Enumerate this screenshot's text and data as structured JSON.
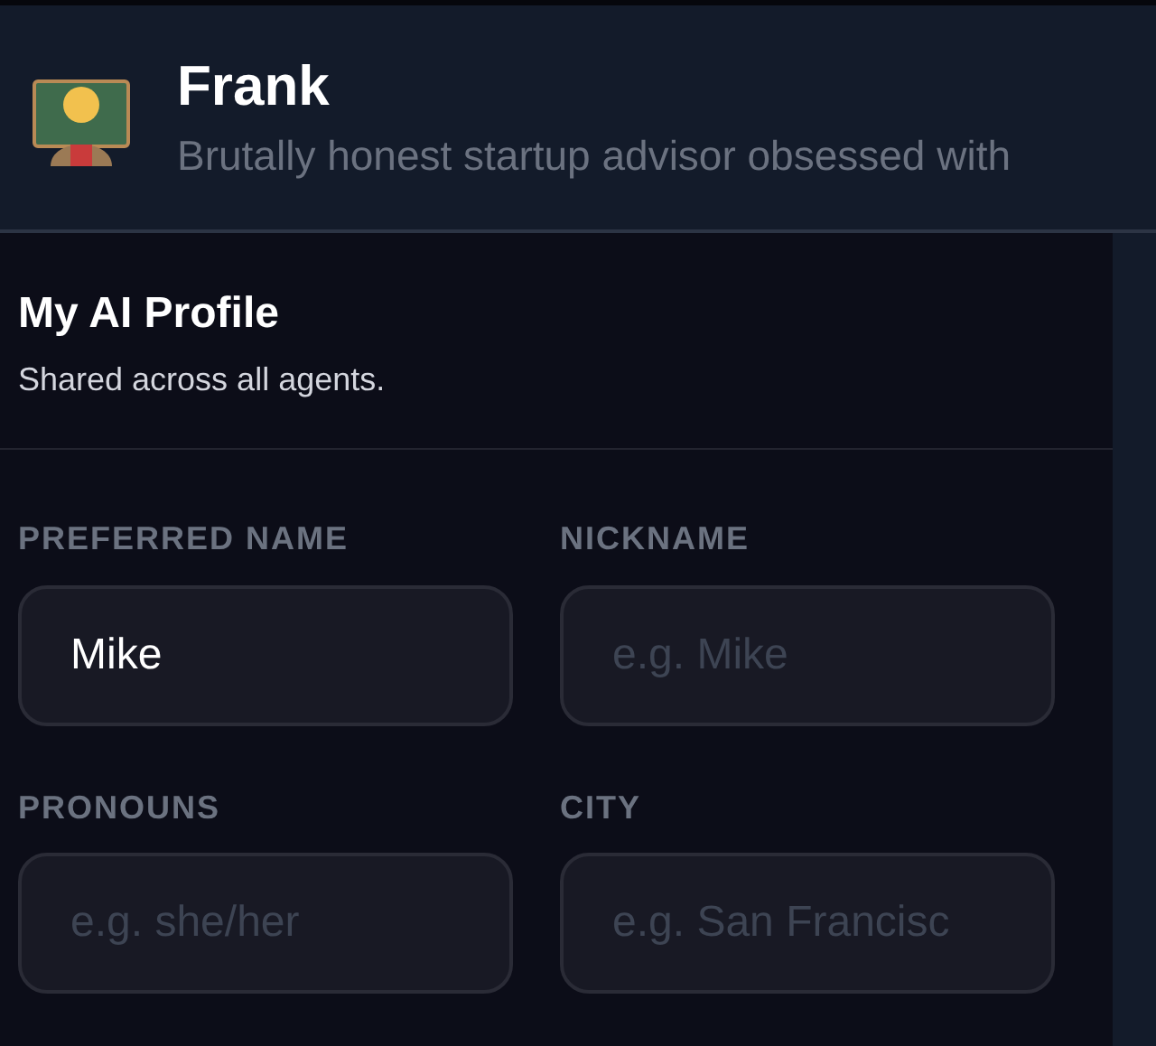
{
  "agent": {
    "name": "Frank",
    "tagline": "Brutally honest startup advisor obsessed with"
  },
  "profile": {
    "title": "My AI Profile",
    "subtitle": "Shared across all agents."
  },
  "fields": [
    {
      "label": "PREFERRED NAME",
      "value": "Mike"
    },
    {
      "label": "NICKNAME",
      "placeholder": "e.g. Mike"
    },
    {
      "label": "PRONOUNS",
      "placeholder": "e.g. she/her"
    },
    {
      "label": "CITY",
      "placeholder": "e.g. San Francisc"
    }
  ]
}
